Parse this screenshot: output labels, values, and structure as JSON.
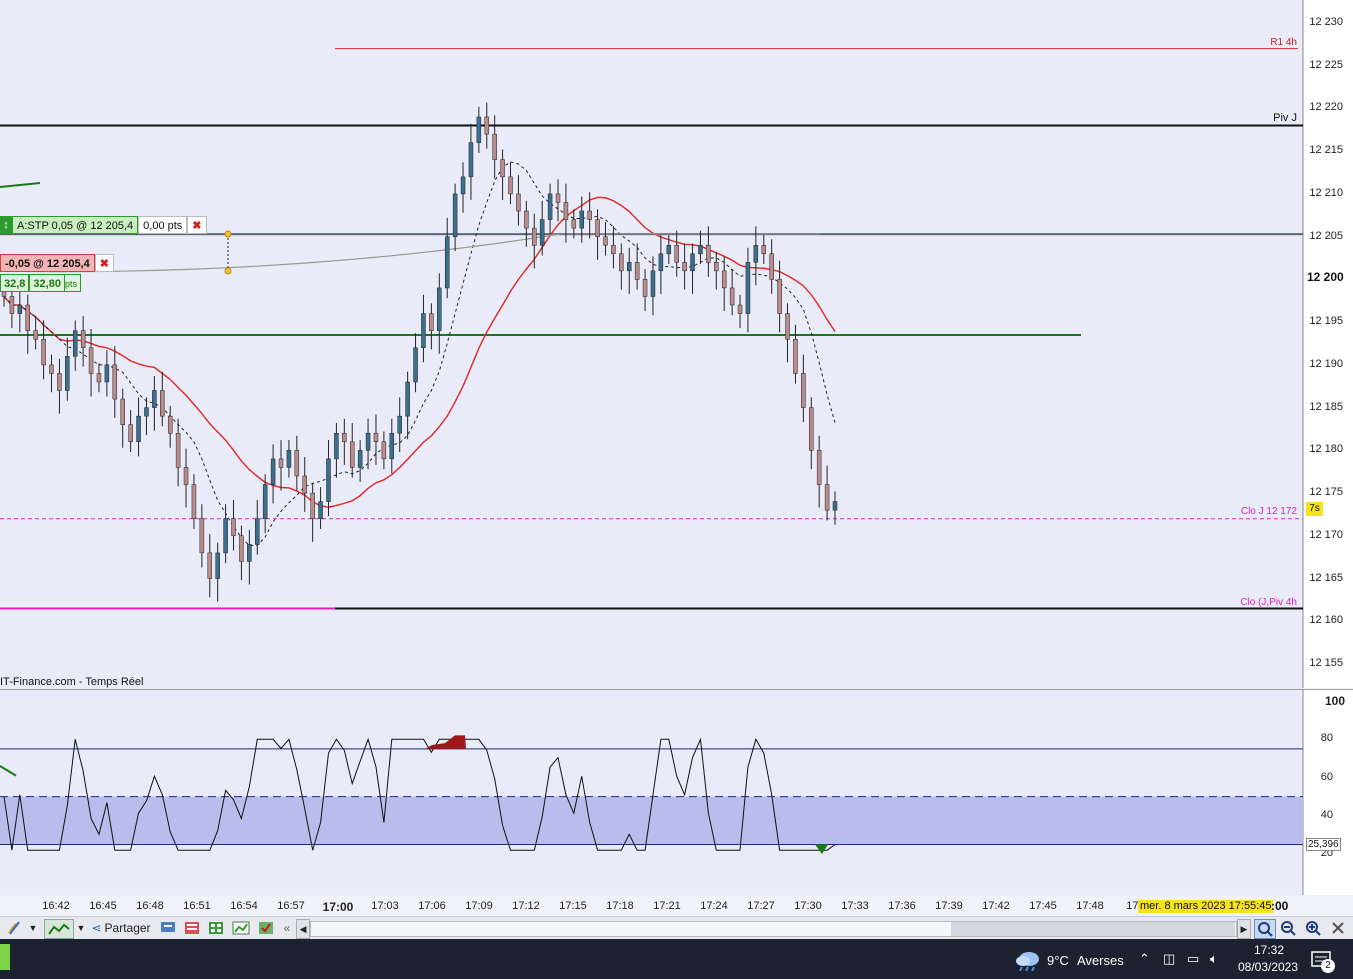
{
  "instrument_source": "IT-Finance.com - Temps Réel",
  "price_axis": {
    "ticks": [
      "12 230",
      "12 225",
      "12 220",
      "12 215",
      "12 210",
      "12 205",
      "12 200",
      "12 195",
      "12 190",
      "12 185",
      "12 180",
      "12 175",
      "12 170",
      "12 165",
      "12 160",
      "12 155"
    ],
    "ticks_values": [
      12230,
      12225,
      12220,
      12215,
      12210,
      12205,
      12200,
      12195,
      12190,
      12185,
      12180,
      12175,
      12170,
      12165,
      12160,
      12155
    ],
    "countdown_badge": "7s"
  },
  "levels": {
    "r1_label": "R1 4h",
    "r1_value": 12227,
    "pivj_label": "Piv J",
    "pivj_value": 12218,
    "clo_label": "Clo J 12 172",
    "clo_value": 12172,
    "bottom_label": "Clo (J,Piv 4h",
    "bottom_value": 12161.5,
    "green_value": 12193.5,
    "purple_value": 12205.3
  },
  "orders": {
    "stop_label": "A:STP  0,05 @ 12 205,4",
    "stop_pts": "0,00 pts",
    "short_label": "-0,05 @ 12 205,4",
    "short_pts_a": "32,8",
    "short_pts_b": "32,80",
    "pts_unit": "pts"
  },
  "rsi": {
    "ticks": [
      "100",
      "80",
      "60",
      "40",
      "20"
    ],
    "ticks_values": [
      100,
      80,
      60,
      40,
      20
    ],
    "upper": 75,
    "mid": 50,
    "lower": 25,
    "current": "25,396"
  },
  "time_axis": {
    "labels": [
      "16:42",
      "16:45",
      "16:48",
      "16:51",
      "16:54",
      "16:57",
      "17:00",
      "17:03",
      "17:06",
      "17:09",
      "17:12",
      "17:15",
      "17:18",
      "17:21",
      "17:24",
      "17:27",
      "17:30",
      "17:33",
      "17:36",
      "17:39",
      "17:42",
      "17:45",
      "17:48",
      "17:5"
    ],
    "bold_label": "17:00",
    "date_tooltip": "mer. 8 mars 2023 17:55:45",
    "trailing": ":00"
  },
  "toolbar": {
    "share_label": "Partager"
  },
  "taskbar": {
    "weather_temp": "9°C",
    "weather_text": "Averses",
    "time": "17:32",
    "date": "08/03/2023",
    "notif_count": "2"
  },
  "colors": {
    "ma_red": "#e03030",
    "level_green": "#1a7a1a",
    "pink": "#e020c0",
    "rsi_fill": "#b8bdec",
    "bull": "#3c6e8e",
    "bear": "#b98c8c"
  },
  "chart_data": {
    "type": "candlestick",
    "closes": [
      12198,
      12196,
      12197,
      12194,
      12193,
      12190,
      12189,
      12187,
      12191,
      12194,
      12192,
      12189,
      12188,
      12190,
      12186,
      12183,
      12181,
      12184,
      12185,
      12187,
      12184,
      12182,
      12178,
      12176,
      12172,
      12168,
      12165,
      12168,
      12172,
      12170,
      12167,
      12169,
      12172,
      12176,
      12179,
      12178,
      12180,
      12177,
      12175,
      12172,
      12174,
      12179,
      12182,
      12181,
      12178,
      12180,
      12182,
      12181,
      12179,
      12182,
      12184,
      12188,
      12192,
      12196,
      12194,
      12199,
      12205,
      12210,
      12212,
      12216,
      12219,
      12217,
      12214,
      12212,
      12210,
      12208,
      12206,
      12204,
      12207,
      12210,
      12209,
      12207,
      12206,
      12208,
      12207,
      12205,
      12204,
      12203,
      12201,
      12202,
      12200,
      12198,
      12201,
      12203,
      12204,
      12202,
      12201,
      12203,
      12204,
      12202,
      12201,
      12199,
      12197,
      12196,
      12202,
      12204,
      12203,
      12200,
      12196,
      12193,
      12189,
      12185,
      12180,
      12176,
      12173,
      12174
    ]
  }
}
